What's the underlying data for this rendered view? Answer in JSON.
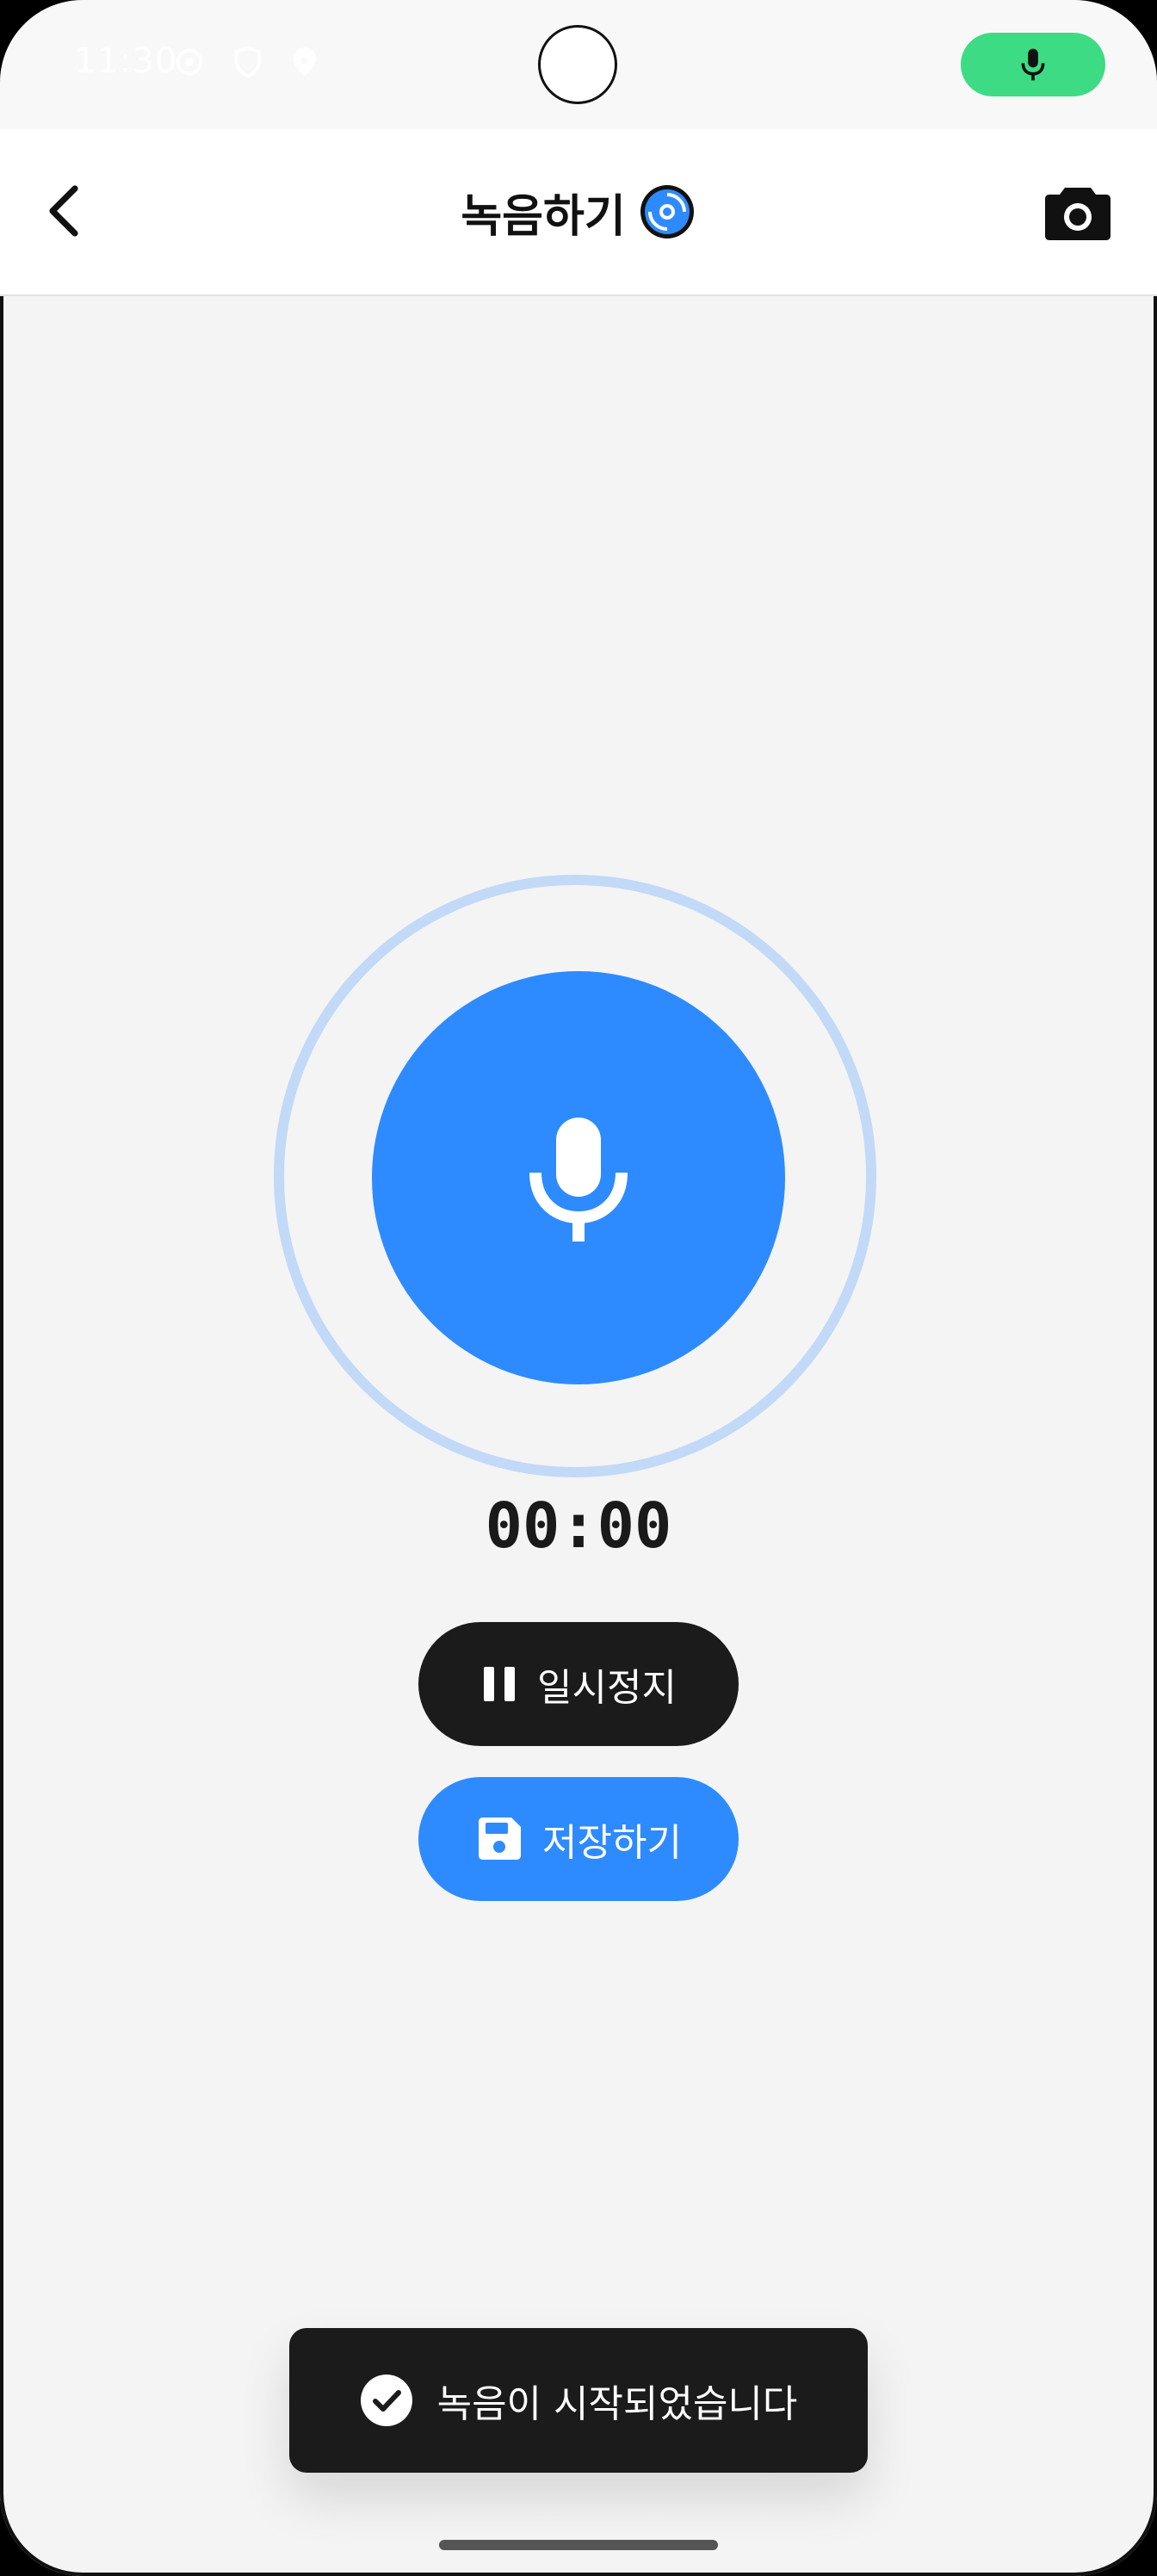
{
  "status_bar": {
    "time": "11:30",
    "icons": [
      "settings-icon",
      "shield-icon",
      "location-icon"
    ],
    "mic_indicator_color": "#3ddc84"
  },
  "app_bar": {
    "title": "녹음하기",
    "title_icon": "disc-icon",
    "back_icon": "chevron-left-icon",
    "action_icon": "camera-icon"
  },
  "recorder": {
    "timer": "00:00",
    "mic_icon": "microphone-icon",
    "accent_color": "#2d8bff",
    "ring_color": "#c2d9f7"
  },
  "controls": {
    "pause_label": "일시정지",
    "save_label": "저장하기"
  },
  "toast": {
    "message": "녹음이 시작되었습니다",
    "icon": "check-circle-icon"
  }
}
